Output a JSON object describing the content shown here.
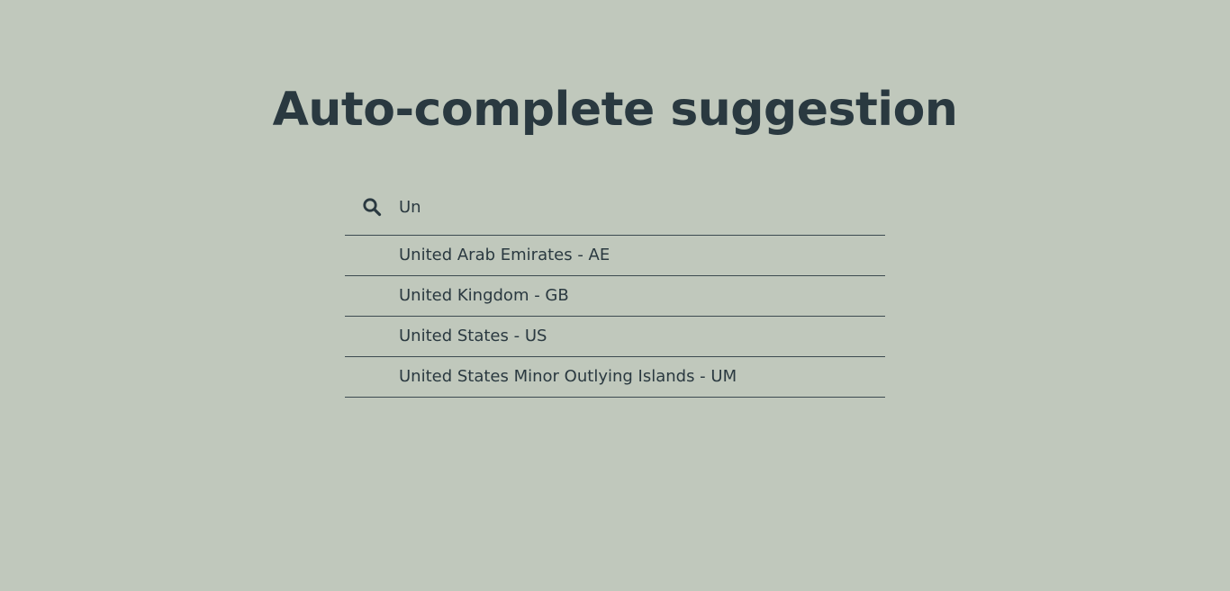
{
  "page": {
    "title": "Auto-complete suggestion"
  },
  "search": {
    "value": "Un",
    "icon": "search-icon"
  },
  "suggestions": [
    {
      "label": "United Arab Emirates - AE"
    },
    {
      "label": "United Kingdom - GB"
    },
    {
      "label": "United States - US"
    },
    {
      "label": "United States Minor Outlying Islands - UM"
    }
  ],
  "colors": {
    "background": "#c0c8bc",
    "text": "#2a3940",
    "divider": "#3c4a50"
  }
}
